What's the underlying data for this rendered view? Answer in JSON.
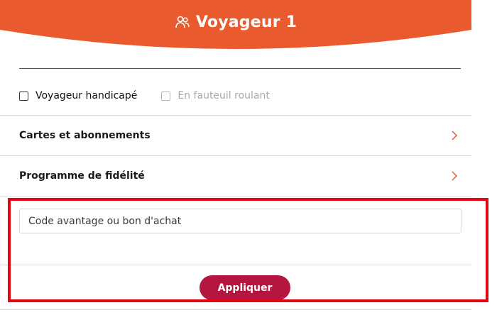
{
  "header": {
    "title": "Voyageur 1",
    "icon": "users-icon",
    "color": "#ea5a2f"
  },
  "options": {
    "handicap_label": "Voyageur handicapé",
    "wheelchair_label": "En fauteuil roulant"
  },
  "rows": [
    {
      "label": "Cartes et abonnements",
      "icon": "chevron-right-icon"
    },
    {
      "label": "Programme de fidélité",
      "icon": "chevron-right-icon"
    }
  ],
  "promo": {
    "placeholder": "Code avantage ou bon d'achat",
    "apply_label": "Appliquer"
  },
  "colors": {
    "accent": "#ea5a2f",
    "button": "#b5163f",
    "chevron": "#e05a3a",
    "highlight": "#e30613"
  }
}
